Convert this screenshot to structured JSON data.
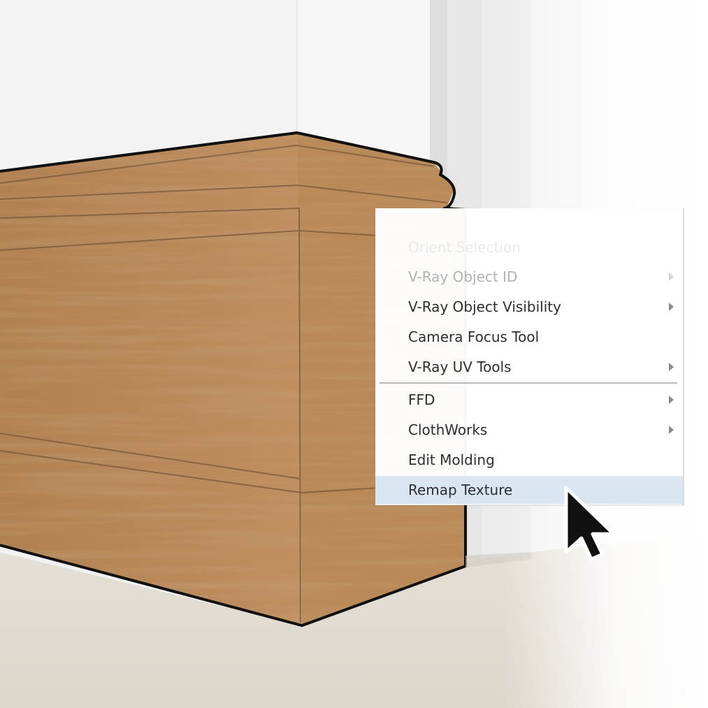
{
  "context_menu": {
    "items": [
      {
        "label": "Orient Selection",
        "state": "faded",
        "submenu": false
      },
      {
        "label": "V-Ray Object ID",
        "state": "disabled",
        "submenu": true
      },
      {
        "label": "V-Ray Object Visibility",
        "state": "normal",
        "submenu": true
      },
      {
        "label": "Camera Focus Tool",
        "state": "normal",
        "submenu": false
      },
      {
        "label": "V-Ray UV Tools",
        "state": "normal",
        "submenu": true
      },
      {
        "label": "FFD",
        "state": "normal",
        "submenu": true
      },
      {
        "label": "ClothWorks",
        "state": "normal",
        "submenu": true
      },
      {
        "label": "Edit Molding",
        "state": "normal",
        "submenu": false
      },
      {
        "label": "Remap Texture",
        "state": "highlighted",
        "submenu": false
      }
    ],
    "highlight_color": "#d9e6f2"
  },
  "scene": {
    "object": "wood baseboard molding",
    "wood_color": "#b68456",
    "wall_color": "#f1f1f1",
    "floor_color": "#e3ddd3"
  },
  "cursor": {
    "icon": "arrow-pointer-icon"
  }
}
